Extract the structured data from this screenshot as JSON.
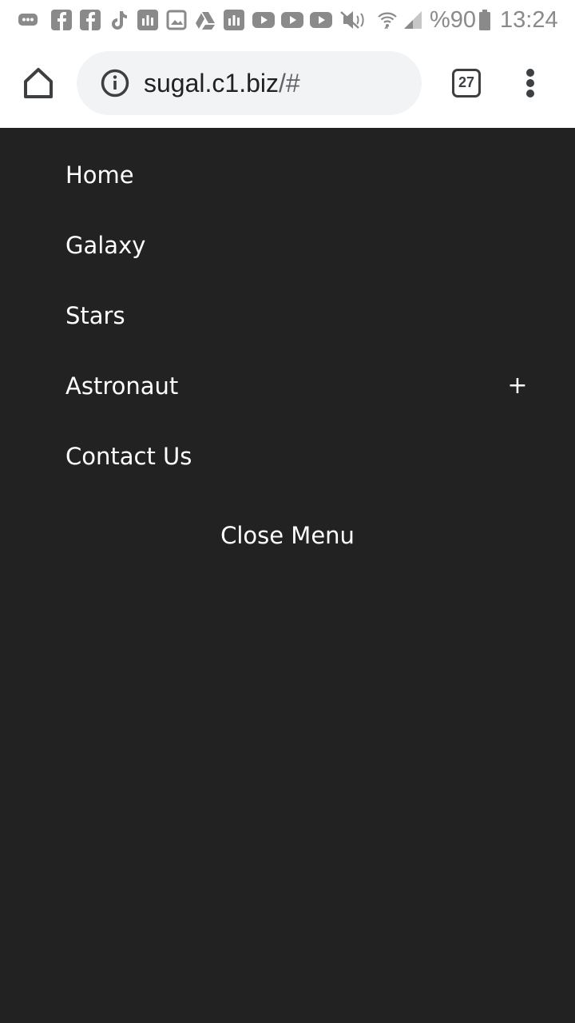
{
  "status_bar": {
    "battery_text": "%90",
    "time": "13:24",
    "icons": [
      "messages-icon",
      "facebook-icon",
      "facebook-icon",
      "tiktok-icon",
      "stats-icon",
      "gallery-icon",
      "drive-icon",
      "stats-icon",
      "youtube-icon",
      "youtube-icon",
      "youtube-icon",
      "mute-icon",
      "wifi-icon",
      "signal-icon",
      "battery-icon"
    ]
  },
  "browser": {
    "url_host": "sugal.c1.biz",
    "url_path": "/#",
    "tab_count": "27"
  },
  "nav": {
    "items": [
      {
        "label": "Home"
      },
      {
        "label": "Galaxy"
      },
      {
        "label": "Stars"
      },
      {
        "label": "Astronaut",
        "expand": "+"
      },
      {
        "label": "Contact Us"
      }
    ],
    "close_label": "Close Menu"
  }
}
